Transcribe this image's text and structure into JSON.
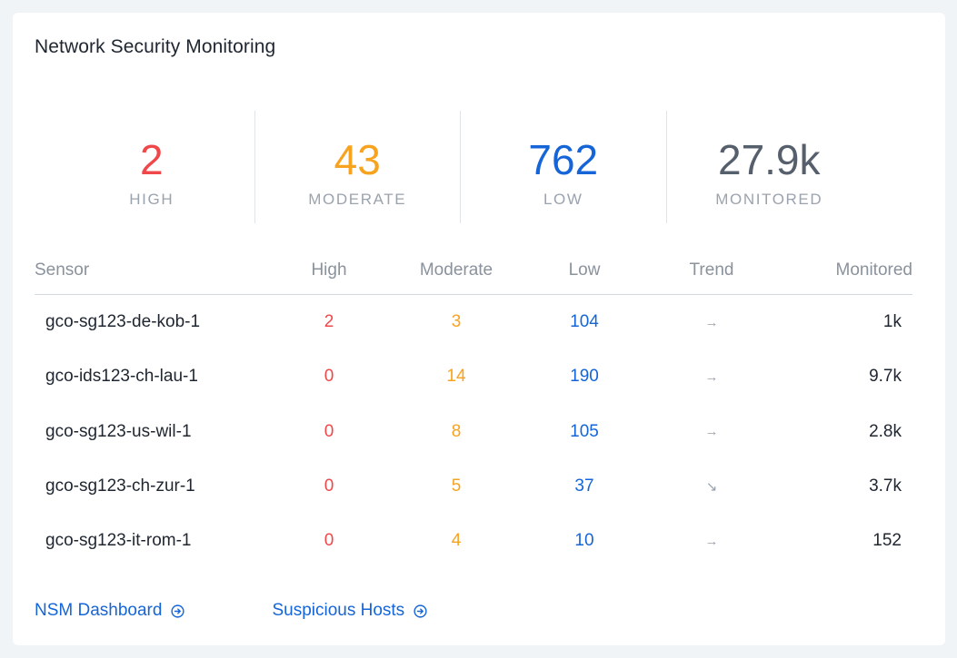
{
  "card": {
    "title": "Network Security Monitoring"
  },
  "stats": [
    {
      "value": "2",
      "label": "HIGH",
      "color": "#f0474a"
    },
    {
      "value": "43",
      "label": "MODERATE",
      "color": "#f7a31f"
    },
    {
      "value": "762",
      "label": "LOW",
      "color": "#1565d8"
    },
    {
      "value": "27.9k",
      "label": "MONITORED",
      "color": "#56606c"
    }
  ],
  "table": {
    "headers": {
      "sensor": "Sensor",
      "high": "High",
      "moderate": "Moderate",
      "low": "Low",
      "trend": "Trend",
      "monitored": "Monitored"
    },
    "rows": [
      {
        "sensor": "gco-sg123-de-kob-1",
        "high": "2",
        "moderate": "3",
        "low": "104",
        "trend": "→",
        "trend_icon": "arrow-right-icon",
        "monitored": "1k"
      },
      {
        "sensor": "gco-ids123-ch-lau-1",
        "high": "0",
        "moderate": "14",
        "low": "190",
        "trend": "→",
        "trend_icon": "arrow-right-icon",
        "monitored": "9.7k"
      },
      {
        "sensor": "gco-sg123-us-wil-1",
        "high": "0",
        "moderate": "8",
        "low": "105",
        "trend": "→",
        "trend_icon": "arrow-right-icon",
        "monitored": "2.8k"
      },
      {
        "sensor": "gco-sg123-ch-zur-1",
        "high": "0",
        "moderate": "5",
        "low": "37",
        "trend": "↘",
        "trend_icon": "arrow-down-right-icon",
        "monitored": "3.7k"
      },
      {
        "sensor": "gco-sg123-it-rom-1",
        "high": "0",
        "moderate": "4",
        "low": "10",
        "trend": "→",
        "trend_icon": "arrow-right-icon",
        "monitored": "152"
      }
    ]
  },
  "links": [
    {
      "label": "NSM Dashboard",
      "icon": "circle-arrow-right-icon"
    },
    {
      "label": "Suspicious Hosts",
      "icon": "circle-arrow-right-icon"
    }
  ],
  "colors": {
    "high": "#f0474a",
    "moderate": "#f7a31f",
    "low": "#1565d8",
    "monitored": "#56606c",
    "link": "#1565d8"
  }
}
